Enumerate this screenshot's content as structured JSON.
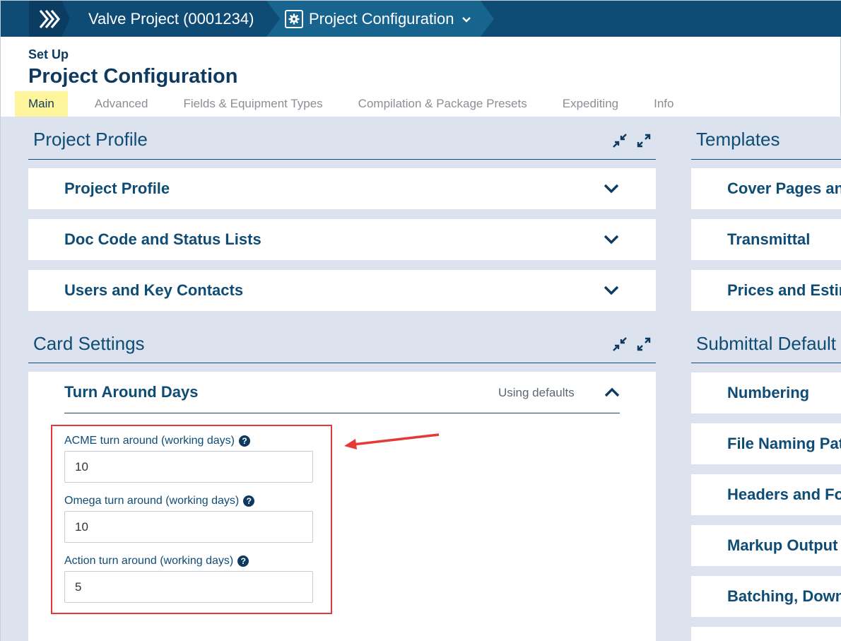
{
  "breadcrumb": {
    "home_icon": "chevrons-right-icon",
    "project": "Valve Project (0001234)",
    "config": "Project Configuration",
    "config_icon": "gear-icon",
    "dropdown_icon": "chevron-down-icon"
  },
  "header": {
    "setup_label": "Set Up",
    "title": "Project Configuration"
  },
  "tabs": [
    {
      "label": "Main",
      "active": true
    },
    {
      "label": "Advanced"
    },
    {
      "label": "Fields & Equipment Types"
    },
    {
      "label": "Compilation & Package Presets"
    },
    {
      "label": "Expediting"
    },
    {
      "label": "Info"
    }
  ],
  "left": {
    "profile_section": {
      "title": "Project Profile",
      "cards": [
        "Project Profile",
        "Doc Code and Status Lists",
        "Users and Key Contacts"
      ]
    },
    "card_settings": {
      "title": "Card Settings",
      "turnaround": {
        "title": "Turn Around Days",
        "status": "Using defaults",
        "fields": [
          {
            "label": "ACME turn around (working days)",
            "value": "10"
          },
          {
            "label": "Omega turn around (working days)",
            "value": "10"
          },
          {
            "label": "Action turn around (working days)",
            "value": "5"
          }
        ]
      }
    }
  },
  "right": {
    "templates": {
      "title": "Templates",
      "cards": [
        "Cover Pages and",
        "Transmittal",
        "Prices and Estim"
      ]
    },
    "submittal": {
      "title": "Submittal Default",
      "cards": [
        "Numbering",
        "File Naming Patt",
        "Headers and Foo",
        "Markup Output",
        "Batching, Downl"
      ]
    }
  },
  "colors": {
    "topbar": "#0f4c75",
    "accent": "#0f4c75",
    "tab_highlight": "#fff59d",
    "annotation": "#e53935"
  }
}
